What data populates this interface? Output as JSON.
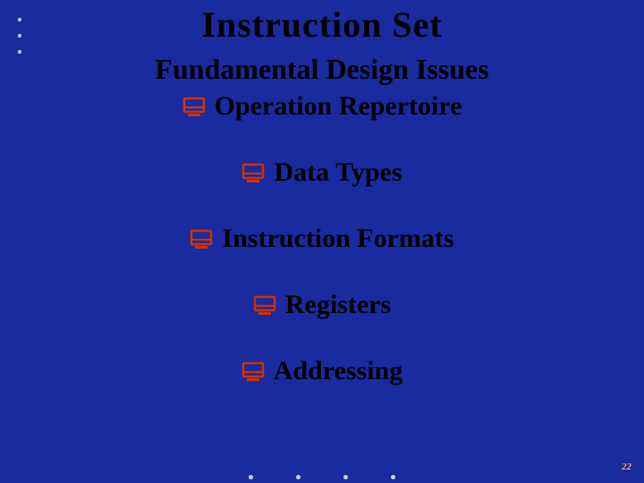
{
  "title": "Instruction  Set",
  "subtitle": "Fundamental   Design   Issues",
  "items": [
    "Operation  Repertoire",
    "Data  Types",
    "Instruction  Formats",
    "Registers",
    "Addressing"
  ],
  "page_number": "22",
  "colors": {
    "background": "#1a2a9f",
    "bullet": "#cc3300",
    "accent": "#f7a83c"
  }
}
